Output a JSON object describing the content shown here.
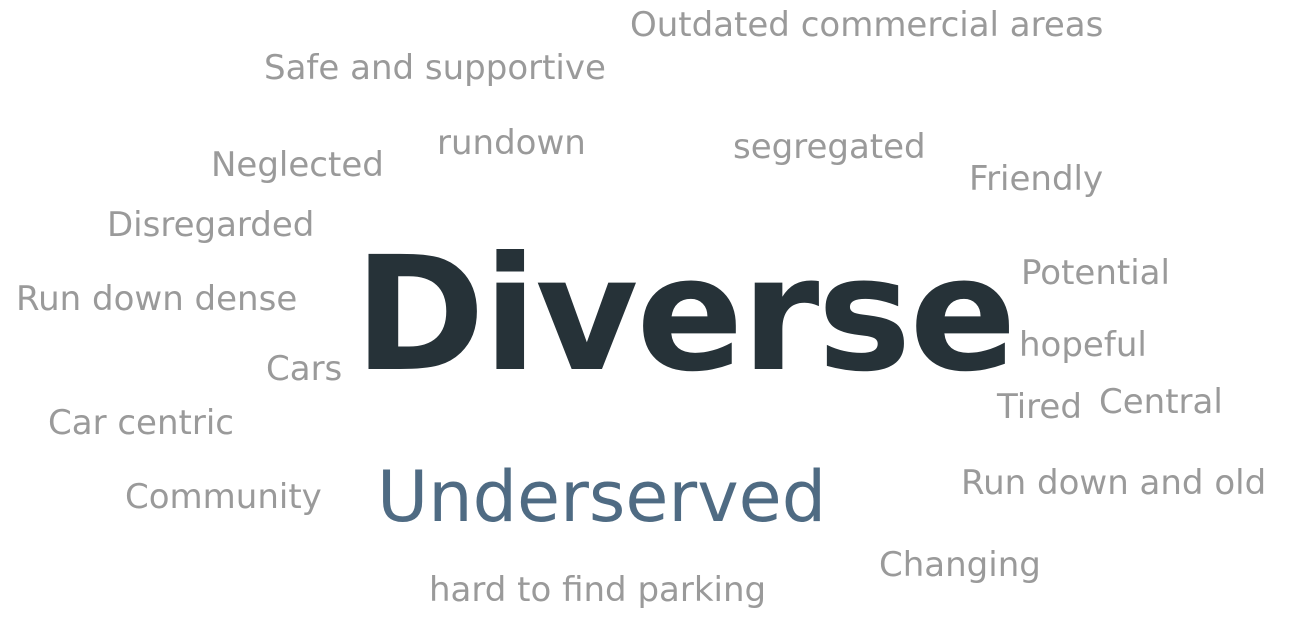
{
  "colors": {
    "primary": "#263238",
    "secondary": "#4f6b83",
    "minor": "#9a9a9a",
    "background": "#ffffff"
  },
  "words": [
    {
      "id": "diverse",
      "text": "Diverse",
      "rank": "primary"
    },
    {
      "id": "underserved",
      "text": "Underserved",
      "rank": "secondary"
    },
    {
      "id": "outdated-commercial-areas",
      "text": "Outdated commercial areas",
      "rank": "minor"
    },
    {
      "id": "safe-and-supportive",
      "text": "Safe and supportive",
      "rank": "minor"
    },
    {
      "id": "rundown",
      "text": "rundown",
      "rank": "minor"
    },
    {
      "id": "segregated",
      "text": "segregated",
      "rank": "minor"
    },
    {
      "id": "neglected",
      "text": "Neglected",
      "rank": "minor"
    },
    {
      "id": "friendly",
      "text": "Friendly",
      "rank": "minor"
    },
    {
      "id": "disregarded",
      "text": "Disregarded",
      "rank": "minor"
    },
    {
      "id": "potential",
      "text": "Potential",
      "rank": "minor"
    },
    {
      "id": "run-down-dense",
      "text": "Run down dense",
      "rank": "minor"
    },
    {
      "id": "hopeful",
      "text": "hopeful",
      "rank": "minor"
    },
    {
      "id": "cars",
      "text": "Cars",
      "rank": "minor"
    },
    {
      "id": "tired",
      "text": "Tired",
      "rank": "minor"
    },
    {
      "id": "central",
      "text": "Central",
      "rank": "minor"
    },
    {
      "id": "car-centric",
      "text": "Car centric",
      "rank": "minor"
    },
    {
      "id": "run-down-and-old",
      "text": "Run down and old",
      "rank": "minor"
    },
    {
      "id": "community",
      "text": "Community",
      "rank": "minor"
    },
    {
      "id": "changing",
      "text": "Changing",
      "rank": "minor"
    },
    {
      "id": "hard-to-find-parking",
      "text": "hard to find parking",
      "rank": "minor"
    }
  ]
}
